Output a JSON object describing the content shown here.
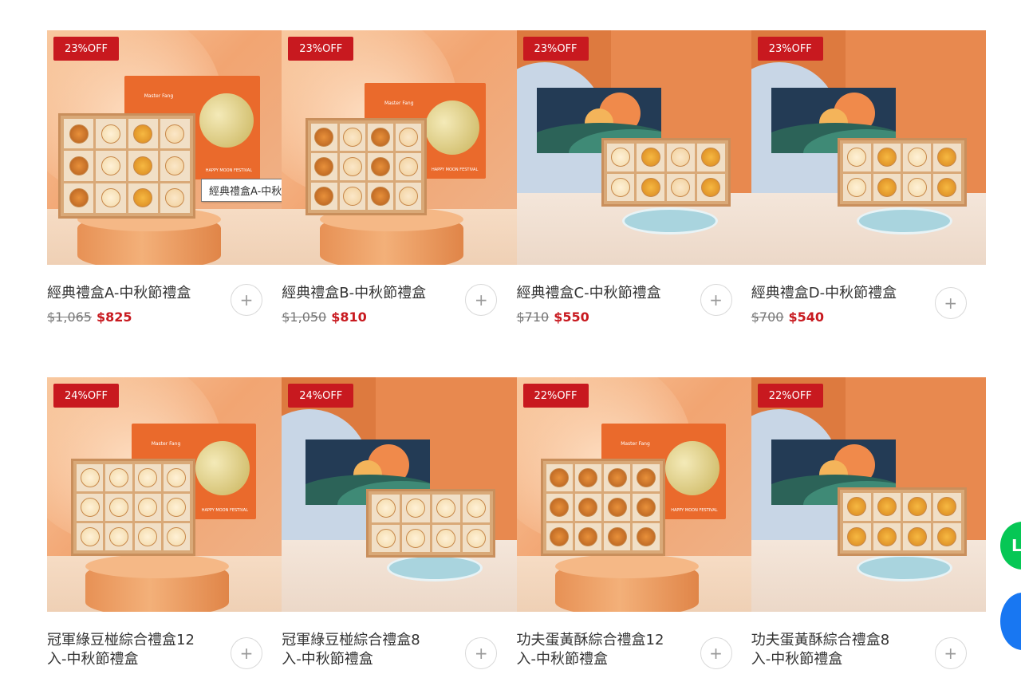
{
  "products": [
    {
      "badge": "23%OFF",
      "title": "經典禮盒A-中秋節禮盒",
      "old_price": "$1,065",
      "price": "$825",
      "tooltip": "經典禮盒A-中秋節禮盒"
    },
    {
      "badge": "23%OFF",
      "title": "經典禮盒B-中秋節禮盒",
      "old_price": "$1,050",
      "price": "$810"
    },
    {
      "badge": "23%OFF",
      "title": "經典禮盒C-中秋節禮盒",
      "old_price": "$710",
      "price": "$550"
    },
    {
      "badge": "23%OFF",
      "title": "經典禮盒D-中秋節禮盒",
      "old_price": "$700",
      "price": "$540"
    },
    {
      "badge": "24%OFF",
      "title": "冠軍綠豆椪綜合禮盒12入-中秋節禮盒"
    },
    {
      "badge": "24%OFF",
      "title": "冠軍綠豆椪綜合禮盒8入-中秋節禮盒"
    },
    {
      "badge": "22%OFF",
      "title": "功夫蛋黃酥綜合禮盒12入-中秋節禮盒"
    },
    {
      "badge": "22%OFF",
      "title": "功夫蛋黃酥綜合禮盒8入-中秋節禮盒"
    }
  ],
  "add_button": {
    "symbol": "+"
  },
  "poster": {
    "brand": "Master Fang",
    "tagline": "HAPPY MOON FESTIVAL"
  },
  "floating": {
    "line_label": "L"
  },
  "colors": {
    "badge": "#c8191f",
    "price": "#c8191f",
    "line": "#06c755",
    "facebook": "#1877f2"
  }
}
